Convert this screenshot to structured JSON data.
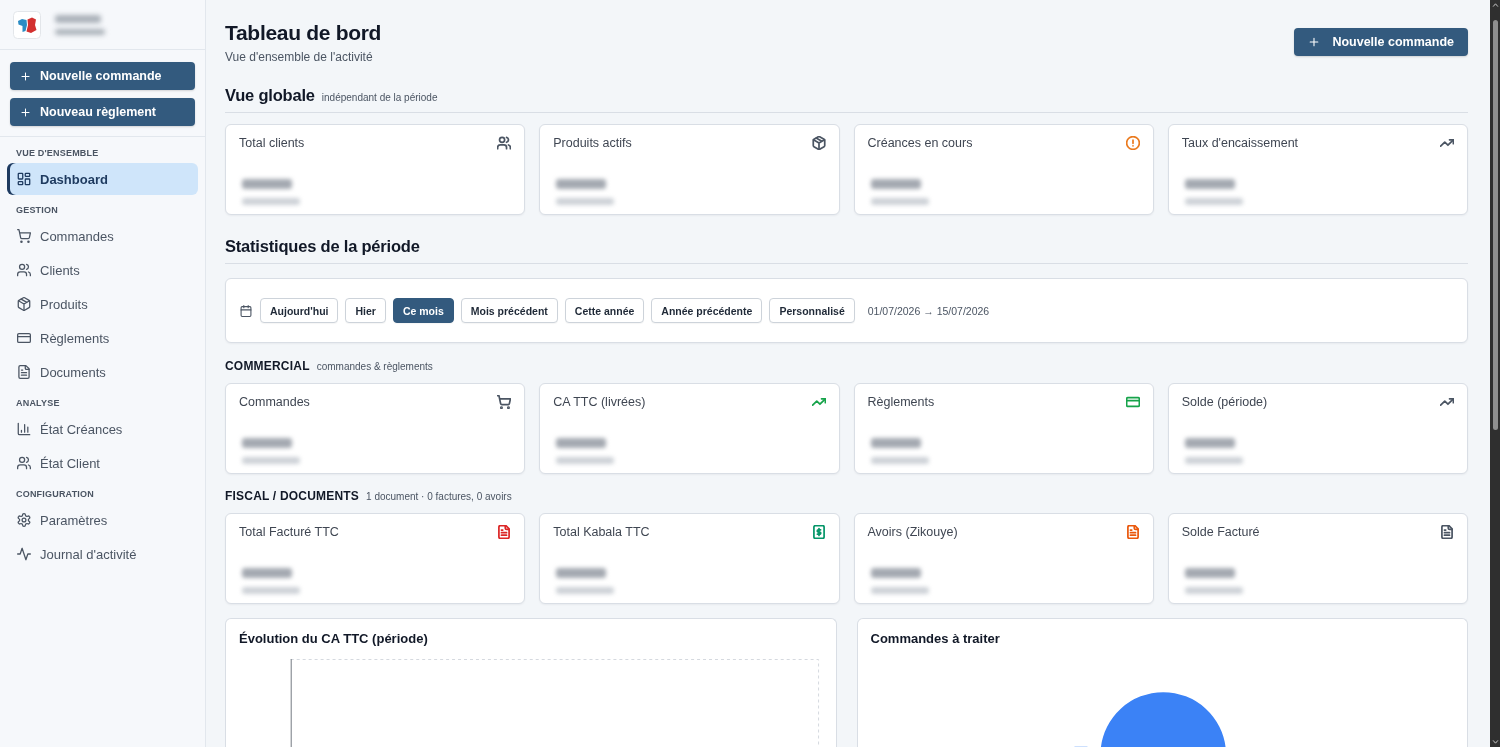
{
  "sidebar": {
    "actions": [
      {
        "label": "Nouvelle commande"
      },
      {
        "label": "Nouveau règlement"
      }
    ],
    "groups": [
      {
        "heading": "VUE D'ENSEMBLE",
        "items": [
          {
            "label": "Dashboard",
            "selected": true
          }
        ]
      },
      {
        "heading": "GESTION",
        "items": [
          {
            "label": "Commandes",
            "selected": false
          },
          {
            "label": "Clients",
            "selected": false
          },
          {
            "label": "Produits",
            "selected": false
          },
          {
            "label": "Règlements",
            "selected": false
          },
          {
            "label": "Documents",
            "selected": false
          }
        ]
      },
      {
        "heading": "ANALYSE",
        "items": [
          {
            "label": "État Créances",
            "selected": false
          },
          {
            "label": "État Client",
            "selected": false
          }
        ]
      },
      {
        "heading": "CONFIGURATION",
        "items": [
          {
            "label": "Paramètres",
            "selected": false
          },
          {
            "label": "Journal d'activité",
            "selected": false
          }
        ]
      }
    ]
  },
  "header": {
    "title": "Tableau de bord",
    "subtitle": "Vue d'ensemble de l'activité",
    "action": "Nouvelle commande"
  },
  "overview": {
    "title": "Vue globale",
    "note": "indépendant de la période",
    "cards": [
      {
        "label": "Total clients",
        "color": "#4b5563"
      },
      {
        "label": "Produits actifs",
        "color": "#4b5563"
      },
      {
        "label": "Créances en cours",
        "color": "#ea7a1e"
      },
      {
        "label": "Taux d'encaissement",
        "color": "#4b5563"
      }
    ]
  },
  "period": {
    "title": "Statistiques de la période",
    "filters": [
      {
        "label": "Aujourd'hui",
        "selected": false
      },
      {
        "label": "Hier",
        "selected": false
      },
      {
        "label": "Ce mois",
        "selected": true
      },
      {
        "label": "Mois précédent",
        "selected": false
      },
      {
        "label": "Cette année",
        "selected": false
      },
      {
        "label": "Année précédente",
        "selected": false
      },
      {
        "label": "Personnalisé",
        "selected": false
      }
    ],
    "range": "01/07/2026 → 15/07/2026"
  },
  "commercial": {
    "title": "COMMERCIAL",
    "note": "commandes & règlements",
    "cards": [
      {
        "label": "Commandes",
        "color": "#4b5563"
      },
      {
        "label": "CA TTC (livrées)",
        "color": "#16a34a"
      },
      {
        "label": "Règlements",
        "color": "#16a34a"
      },
      {
        "label": "Solde (période)",
        "color": "#4b5563"
      }
    ]
  },
  "fiscal": {
    "title": "FISCAL / DOCUMENTS",
    "note": "1 document · 0 factures, 0 avoirs",
    "cards": [
      {
        "label": "Total Facturé TTC",
        "color": "#dc2626"
      },
      {
        "label": "Total Kabala TTC",
        "color": "#059669"
      },
      {
        "label": "Avoirs (Zikouye)",
        "color": "#ea580c"
      },
      {
        "label": "Solde Facturé",
        "color": "#4b5563"
      }
    ]
  },
  "panels": [
    {
      "kind": "line",
      "title": "Évolution du CA TTC (période)"
    },
    {
      "kind": "pie",
      "title": "Commandes à traiter"
    }
  ]
}
